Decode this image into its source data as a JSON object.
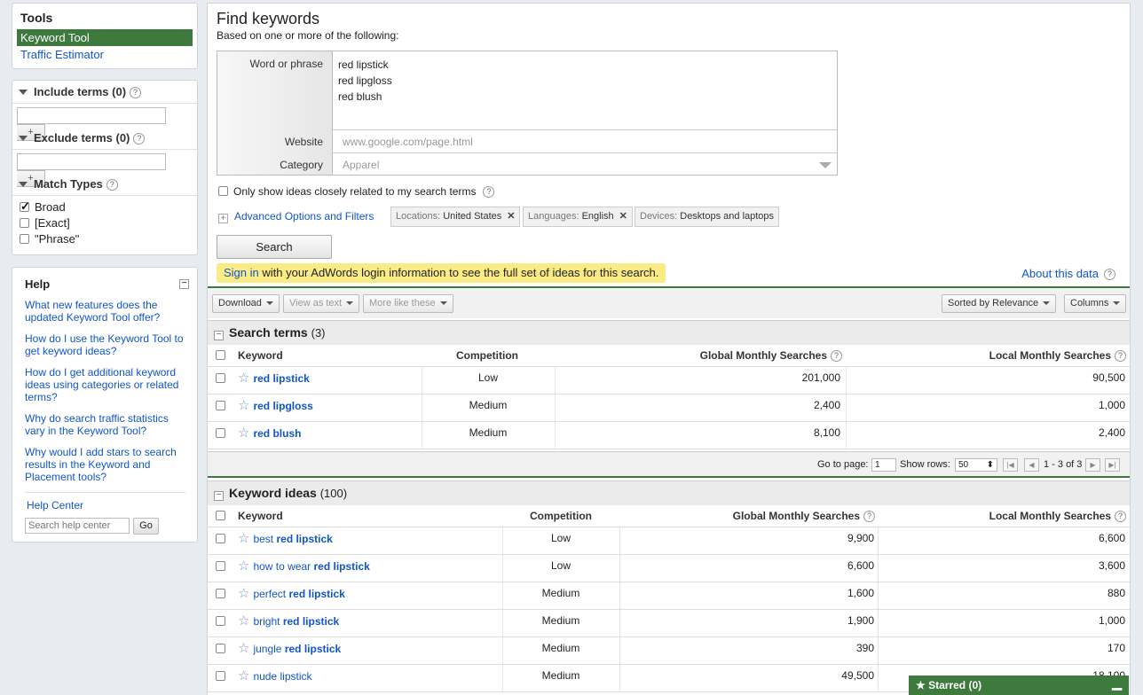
{
  "sidebar": {
    "tools": {
      "title": "Tools",
      "items": [
        "Keyword Tool",
        "Traffic Estimator"
      ]
    },
    "include": {
      "label": "Include terms (0)"
    },
    "exclude": {
      "label": "Exclude terms (0)"
    },
    "match_types": {
      "label": "Match Types",
      "options": [
        {
          "label": "Broad",
          "checked": true
        },
        {
          "label": "[Exact]",
          "checked": false
        },
        {
          "label": "\"Phrase\"",
          "checked": false
        }
      ]
    },
    "help": {
      "title": "Help",
      "questions": [
        "What new features does the updated Keyword Tool offer?",
        "How do I use the Keyword Tool to get keyword ideas?",
        "How do I get additional keyword ideas using categories or related terms?",
        "Why do search traffic statistics vary in the Keyword Tool?",
        "Why would I add stars to search results in the Keyword and Placement tools?"
      ],
      "center": "Help Center",
      "search_placeholder": "Search help center",
      "go": "Go"
    }
  },
  "main": {
    "title": "Find keywords",
    "subtitle": "Based on one or more of the following:",
    "form": {
      "word_label": "Word or phrase",
      "words": [
        "red lipstick",
        "red lipgloss",
        "red blush"
      ],
      "website_label": "Website",
      "website_placeholder": "www.google.com/page.html",
      "category_label": "Category",
      "category_placeholder": "Apparel"
    },
    "only_show": "Only show ideas closely related to my search terms",
    "advanced": "Advanced Options and Filters",
    "chips": [
      {
        "key": "Locations:",
        "value": "United States"
      },
      {
        "key": "Languages:",
        "value": "English"
      },
      {
        "key": "Devices:",
        "value": "Desktops and laptops"
      }
    ],
    "search_button": "Search",
    "signin_link": "Sign in",
    "signin_rest": " with your AdWords login information to see the full set of ideas for this search.",
    "about": "About this data",
    "toolbar": {
      "download": "Download",
      "view_text": "View as text",
      "more_like": "More like these",
      "sorted": "Sorted by Relevance",
      "columns": "Columns"
    },
    "headers": {
      "keyword": "Keyword",
      "competition": "Competition",
      "global": "Global Monthly Searches",
      "local": "Local Monthly Searches"
    },
    "search_terms": {
      "title": "Search terms",
      "count": "(3)",
      "rows": [
        {
          "kw_pre": "",
          "kw_bold": "red lipstick",
          "competition": "Low",
          "global": "201,000",
          "local": "90,500"
        },
        {
          "kw_pre": "",
          "kw_bold": "red lipgloss",
          "competition": "Medium",
          "global": "2,400",
          "local": "1,000"
        },
        {
          "kw_pre": "",
          "kw_bold": "red blush",
          "competition": "Medium",
          "global": "8,100",
          "local": "2,400"
        }
      ]
    },
    "pager": {
      "go_to": "Go to page:",
      "page": "1",
      "show_rows": "Show rows:",
      "rows": "50",
      "range": "1 - 3 of 3"
    },
    "keyword_ideas": {
      "title": "Keyword ideas",
      "count": "(100)",
      "rows": [
        {
          "kw_pre": "best ",
          "kw_bold": "red lipstick",
          "competition": "Low",
          "global": "9,900",
          "local": "6,600"
        },
        {
          "kw_pre": "how to wear ",
          "kw_bold": "red lipstick",
          "competition": "Low",
          "global": "6,600",
          "local": "3,600"
        },
        {
          "kw_pre": "perfect ",
          "kw_bold": "red lipstick",
          "competition": "Medium",
          "global": "1,600",
          "local": "880"
        },
        {
          "kw_pre": "bright ",
          "kw_bold": "red lipstick",
          "competition": "Medium",
          "global": "1,900",
          "local": "1,000"
        },
        {
          "kw_pre": "jungle ",
          "kw_bold": "red lipstick",
          "competition": "Medium",
          "global": "390",
          "local": "170"
        },
        {
          "kw_pre": "nude lipstick",
          "kw_bold": "",
          "competition": "Medium",
          "global": "49,500",
          "local": "18,100"
        }
      ]
    },
    "starred": "Starred (0)"
  }
}
